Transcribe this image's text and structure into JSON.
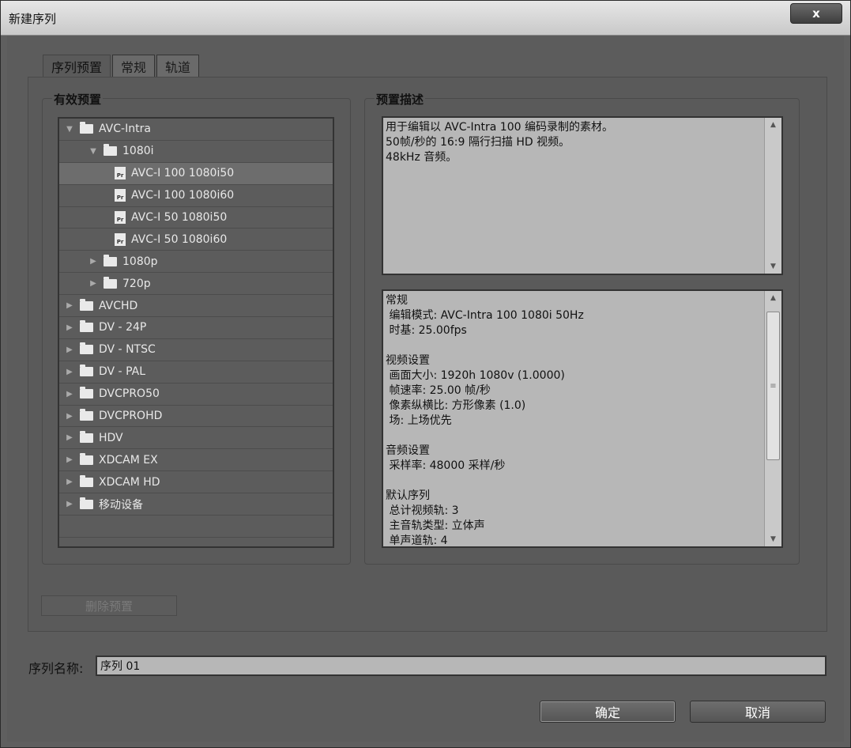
{
  "window": {
    "title": "新建序列",
    "close_label": "x"
  },
  "tabs": [
    {
      "label": "序列预置",
      "active": true
    },
    {
      "label": "常规",
      "active": false
    },
    {
      "label": "轨道",
      "active": false
    }
  ],
  "presets": {
    "group_title": "有效预置",
    "items": [
      {
        "label": "AVC-Intra",
        "kind": "folder",
        "level": 0,
        "expanded": true
      },
      {
        "label": "1080i",
        "kind": "folder",
        "level": 1,
        "expanded": true
      },
      {
        "label": "AVC-I 100 1080i50",
        "kind": "preset",
        "level": 2,
        "selected": true
      },
      {
        "label": "AVC-I 100 1080i60",
        "kind": "preset",
        "level": 2
      },
      {
        "label": "AVC-I 50 1080i50",
        "kind": "preset",
        "level": 2
      },
      {
        "label": "AVC-I 50 1080i60",
        "kind": "preset",
        "level": 2
      },
      {
        "label": "1080p",
        "kind": "folder",
        "level": 1,
        "expanded": false
      },
      {
        "label": "720p",
        "kind": "folder",
        "level": 1,
        "expanded": false
      },
      {
        "label": "AVCHD",
        "kind": "folder",
        "level": 0,
        "expanded": false
      },
      {
        "label": "DV - 24P",
        "kind": "folder",
        "level": 0,
        "expanded": false
      },
      {
        "label": "DV - NTSC",
        "kind": "folder",
        "level": 0,
        "expanded": false
      },
      {
        "label": "DV - PAL",
        "kind": "folder",
        "level": 0,
        "expanded": false
      },
      {
        "label": "DVCPRO50",
        "kind": "folder",
        "level": 0,
        "expanded": false
      },
      {
        "label": "DVCPROHD",
        "kind": "folder",
        "level": 0,
        "expanded": false
      },
      {
        "label": "HDV",
        "kind": "folder",
        "level": 0,
        "expanded": false
      },
      {
        "label": "XDCAM EX",
        "kind": "folder",
        "level": 0,
        "expanded": false
      },
      {
        "label": "XDCAM HD",
        "kind": "folder",
        "level": 0,
        "expanded": false
      },
      {
        "label": "移动设备",
        "kind": "folder",
        "level": 0,
        "expanded": false
      }
    ],
    "preset_icon_text": "Pr"
  },
  "description": {
    "group_title": "预置描述",
    "text": "用于编辑以 AVC-Intra 100 编码录制的素材。\n50帧/秒的 16:9 隔行扫描 HD 视频。\n48kHz 音频。"
  },
  "details": {
    "text": "常规\n 编辑模式: AVC-Intra 100 1080i 50Hz\n 时基: 25.00fps\n\n视频设置\n 画面大小: 1920h 1080v (1.0000)\n 帧速率: 25.00 帧/秒\n 像素纵横比: 方形像素 (1.0)\n 场: 上场优先\n\n音频设置\n 采样率: 48000 采样/秒\n\n默认序列\n 总计视频轨: 3\n 主音轨类型: 立体声\n 单声道轨: 4"
  },
  "delete_preset_label": "删除预置",
  "sequence_name": {
    "label": "序列名称:",
    "value": "序列 01"
  },
  "buttons": {
    "ok": "确定",
    "cancel": "取消"
  }
}
